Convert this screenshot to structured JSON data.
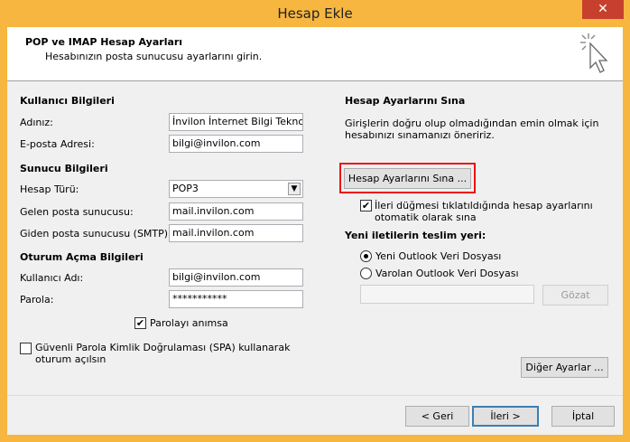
{
  "window": {
    "title": "Hesap Ekle",
    "close_glyph": "✕"
  },
  "header": {
    "title": "POP ve IMAP Hesap Ayarları",
    "subtitle": "Hesabınızın posta sunucusu ayarlarını girin."
  },
  "user_info": {
    "section": "Kullanıcı Bilgileri",
    "name_label": "Adınız:",
    "name_value": "İnvilon İnternet Bilgi Teknoloj",
    "email_label": "E-posta Adresi:",
    "email_value": "bilgi@invilon.com"
  },
  "server_info": {
    "section": "Sunucu Bilgileri",
    "type_label": "Hesap Türü:",
    "type_value": "POP3",
    "incoming_label": "Gelen posta sunucusu:",
    "incoming_value": "mail.invilon.com",
    "outgoing_label": "Giden posta sunucusu (SMTP):",
    "outgoing_value": "mail.invilon.com"
  },
  "logon_info": {
    "section": "Oturum Açma Bilgileri",
    "username_label": "Kullanıcı Adı:",
    "username_value": "bilgi@invilon.com",
    "password_label": "Parola:",
    "password_value": "***********",
    "remember_label": "Parolayı anımsa",
    "spa_label_1": "Güvenli Parola Kimlik Doğrulaması (SPA) kullanarak",
    "spa_label_2": "oturum açılsın"
  },
  "test": {
    "section": "Hesap Ayarlarını Sına",
    "desc_1": "Girişlerin doğru olup olmadığından emin olmak için",
    "desc_2": "hesabınızı sınamanızı öneririz.",
    "button": "Hesap Ayarlarını Sına ...",
    "auto_label_1": "İleri düğmesi tıklatıldığında hesap ayarlarını",
    "auto_label_2": "otomatik olarak sına"
  },
  "delivery": {
    "section": "Yeni iletilerin teslim yeri:",
    "new_file": "Yeni Outlook Veri Dosyası",
    "existing_file": "Varolan Outlook Veri Dosyası",
    "browse": "Gözat"
  },
  "more_settings": "Diğer Ayarlar ...",
  "footer": {
    "back": "< Geri",
    "next": "İleri >",
    "cancel": "İptal"
  },
  "check_glyph": "✔"
}
